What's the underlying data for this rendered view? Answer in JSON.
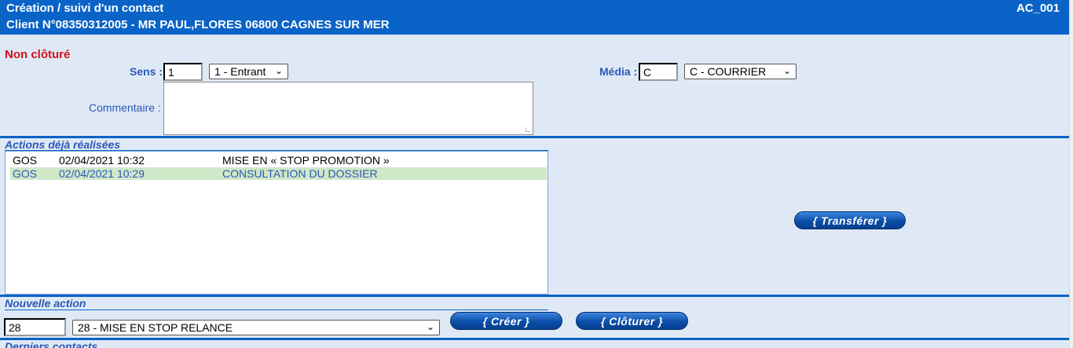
{
  "header": {
    "title": "Création / suivi d'un contact",
    "client": "Client N°08350312005 - MR PAUL,FLORES 06800 CAGNES SUR MER",
    "screen_code": "AC_001"
  },
  "status": "Non clôturé",
  "form": {
    "sens_label": "Sens :",
    "sens_code": "1",
    "sens_option": "1 - Entrant",
    "media_label": "Média :",
    "media_code": "C",
    "media_option": "C - COURRIER",
    "comment_label": "Commentaire :",
    "comment_value": ""
  },
  "actions": {
    "title": "Actions déjà réalisées",
    "rows": [
      {
        "user": "GOS",
        "date": "02/04/2021 10:32",
        "action": "MISE EN « STOP PROMOTION »"
      },
      {
        "user": "GOS",
        "date": "02/04/2021 10:29",
        "action": "CONSULTATION DU DOSSIER"
      }
    ],
    "transfer_button": "{ Transférer }"
  },
  "new_action": {
    "title": "Nouvelle action",
    "code": "28",
    "option": "28 - MISE EN STOP RELANCE",
    "create_button": "{     Créer     }",
    "close_button": "{  Clôturer  }"
  },
  "last_contacts_title": "Derniers contacts",
  "colors": {
    "header_blue": "#0a63c6",
    "panel_bg": "#dfe9f5",
    "label_blue": "#2c58b8",
    "status_red": "#d0101a",
    "selected_row": "#cfe8c8"
  }
}
